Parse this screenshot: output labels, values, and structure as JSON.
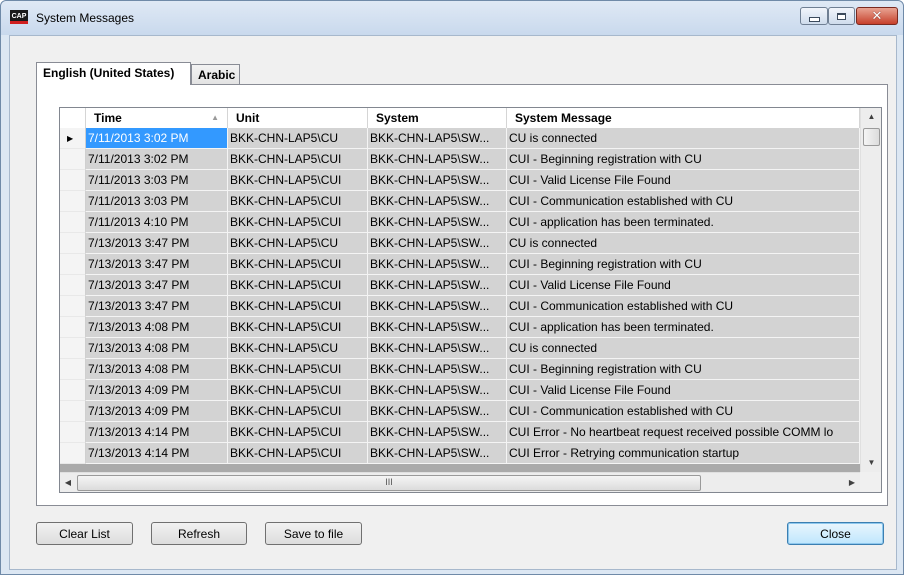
{
  "window": {
    "app_icon_text": "CAP",
    "title": "System Messages",
    "close_glyph": "✕"
  },
  "tabs": [
    {
      "label": "English (United States)",
      "active": true
    },
    {
      "label": "Arabic",
      "active": false
    }
  ],
  "grid": {
    "columns": [
      "Time",
      "Unit",
      "System",
      "System Message"
    ],
    "sorted_column": "Time",
    "sort_direction": "ascending",
    "selected_row": 0,
    "rows": [
      [
        "7/11/2013 3:02 PM",
        "BKK-CHN-LAP5\\CU",
        "BKK-CHN-LAP5\\SW...",
        "CU is connected"
      ],
      [
        "7/11/2013 3:02 PM",
        "BKK-CHN-LAP5\\CUI",
        "BKK-CHN-LAP5\\SW...",
        "CUI - Beginning registration with CU"
      ],
      [
        "7/11/2013 3:03 PM",
        "BKK-CHN-LAP5\\CUI",
        "BKK-CHN-LAP5\\SW...",
        "CUI - Valid License File Found"
      ],
      [
        "7/11/2013 3:03 PM",
        "BKK-CHN-LAP5\\CUI",
        "BKK-CHN-LAP5\\SW...",
        "CUI - Communication established with CU"
      ],
      [
        "7/11/2013 4:10 PM",
        "BKK-CHN-LAP5\\CUI",
        "BKK-CHN-LAP5\\SW...",
        "CUI - application has been terminated."
      ],
      [
        "7/13/2013 3:47 PM",
        "BKK-CHN-LAP5\\CU",
        "BKK-CHN-LAP5\\SW...",
        "CU is connected"
      ],
      [
        "7/13/2013 3:47 PM",
        "BKK-CHN-LAP5\\CUI",
        "BKK-CHN-LAP5\\SW...",
        "CUI - Beginning registration with CU"
      ],
      [
        "7/13/2013 3:47 PM",
        "BKK-CHN-LAP5\\CUI",
        "BKK-CHN-LAP5\\SW...",
        "CUI - Valid License File Found"
      ],
      [
        "7/13/2013 3:47 PM",
        "BKK-CHN-LAP5\\CUI",
        "BKK-CHN-LAP5\\SW...",
        "CUI - Communication established with CU"
      ],
      [
        "7/13/2013 4:08 PM",
        "BKK-CHN-LAP5\\CUI",
        "BKK-CHN-LAP5\\SW...",
        "CUI - application has been terminated."
      ],
      [
        "7/13/2013 4:08 PM",
        "BKK-CHN-LAP5\\CU",
        "BKK-CHN-LAP5\\SW...",
        "CU is connected"
      ],
      [
        "7/13/2013 4:08 PM",
        "BKK-CHN-LAP5\\CUI",
        "BKK-CHN-LAP5\\SW...",
        "CUI - Beginning registration with CU"
      ],
      [
        "7/13/2013 4:09 PM",
        "BKK-CHN-LAP5\\CUI",
        "BKK-CHN-LAP5\\SW...",
        "CUI - Valid License File Found"
      ],
      [
        "7/13/2013 4:09 PM",
        "BKK-CHN-LAP5\\CUI",
        "BKK-CHN-LAP5\\SW...",
        "CUI - Communication established with CU"
      ],
      [
        "7/13/2013 4:14 PM",
        "BKK-CHN-LAP5\\CUI",
        "BKK-CHN-LAP5\\SW...",
        "CUI Error - No heartbeat request received possible COMM lo"
      ],
      [
        "7/13/2013 4:14 PM",
        "BKK-CHN-LAP5\\CUI",
        "BKK-CHN-LAP5\\SW...",
        "CUI Error - Retrying communication startup"
      ]
    ],
    "hscroll_grip": "III"
  },
  "buttons": {
    "clear": "Clear List",
    "refresh": "Refresh",
    "save": "Save to file",
    "close": "Close"
  },
  "colors": {
    "selection": "#3399ff",
    "row_background": "#d3d3d3",
    "grid_background": "#aaaaaa",
    "close_button_red": "#c7402b"
  }
}
